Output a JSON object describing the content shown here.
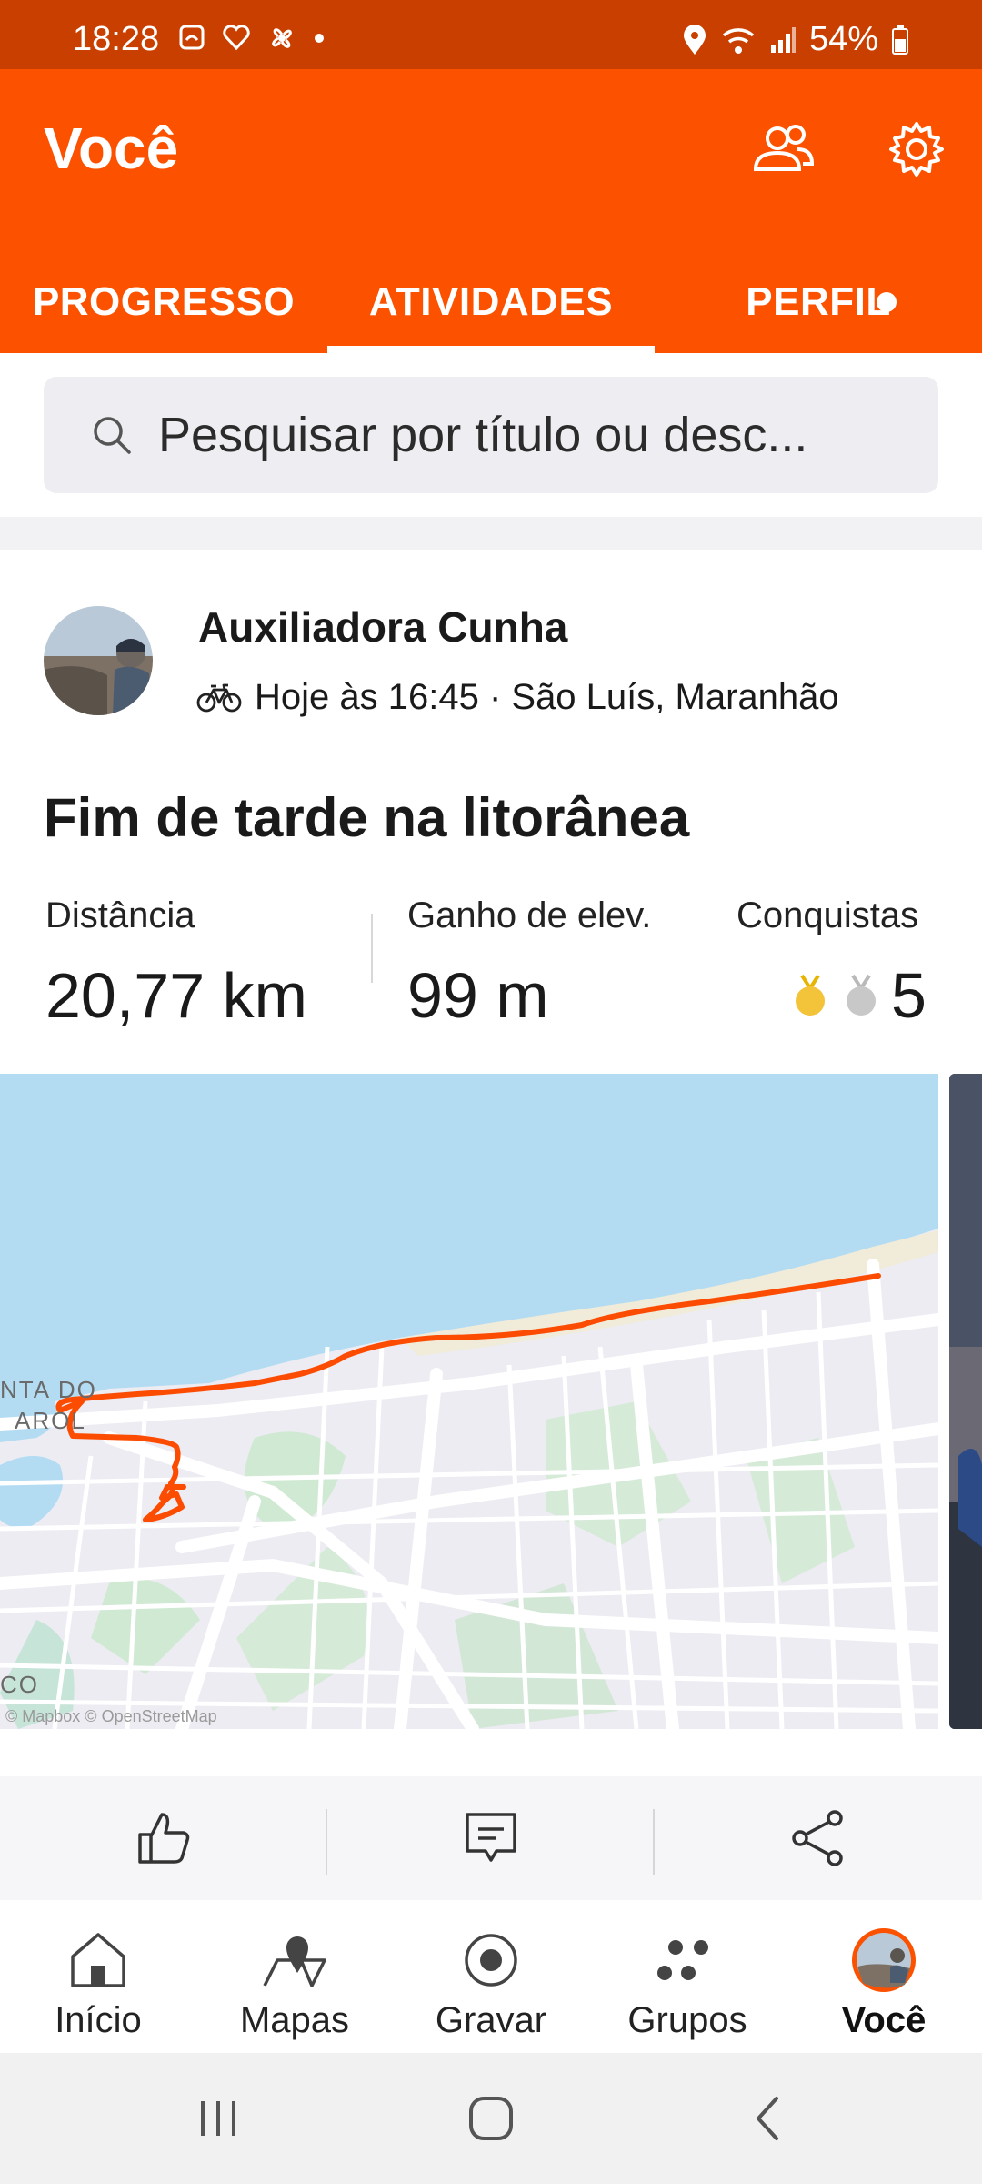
{
  "status_bar": {
    "time": "18:28",
    "battery": "54%"
  },
  "header": {
    "title": "Você"
  },
  "tabs": [
    {
      "label": "PROGRESSO",
      "active": false
    },
    {
      "label": "ATIVIDADES",
      "active": true
    },
    {
      "label": "PERFIL",
      "active": false,
      "has_dot": true
    }
  ],
  "search": {
    "placeholder": "Pesquisar por título ou desc..."
  },
  "activity": {
    "athlete": "Auxiliadora Cunha",
    "meta": "Hoje às 16:45 · São Luís, Maranhão",
    "title": "Fim de tarde na litorânea",
    "stats": {
      "distance_label": "Distância",
      "distance_value": "20,77 km",
      "elevation_label": "Ganho de elev.",
      "elevation_value": "99 m",
      "achievements_label": "Conquistas",
      "achievements_value": "5"
    },
    "map": {
      "place_label_1": "NTA DO",
      "place_label_2": "AROL",
      "place_label_3": "CO",
      "attribution": "© Mapbox © OpenStreetMap"
    }
  },
  "bottom_nav": [
    {
      "label": "Início",
      "icon": "home-icon"
    },
    {
      "label": "Mapas",
      "icon": "map-icon"
    },
    {
      "label": "Gravar",
      "icon": "record-icon"
    },
    {
      "label": "Grupos",
      "icon": "groups-icon"
    },
    {
      "label": "Você",
      "icon": "avatar-icon",
      "active": true
    }
  ],
  "colors": {
    "brand": "#fc5200",
    "status_bar": "#c93f00",
    "route": "#fc4c02",
    "water": "#b3dcf3"
  }
}
